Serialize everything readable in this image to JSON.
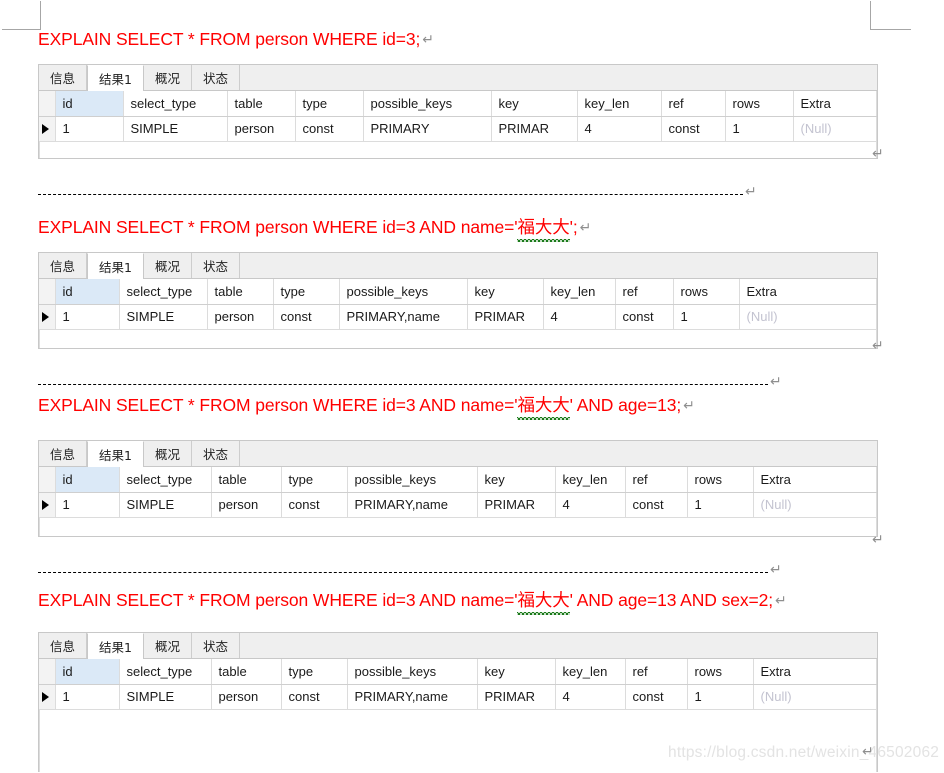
{
  "document": {
    "watermark": "https://blog.csdn.net/weixin_46502062",
    "pilcrow_glyph": "↵",
    "separator_text": "-------------------------------------------------------------------------------------------------------------------"
  },
  "blocks": [
    {
      "sql_prefix": "EXPLAIN SELECT * FROM person WHERE id=3;",
      "sql_cjk": "",
      "sql_suffix": "",
      "tabs": [
        {
          "label": "信息",
          "active": false
        },
        {
          "label": "结果1",
          "active": true
        },
        {
          "label": "概况",
          "active": false
        },
        {
          "label": "状态",
          "active": false
        }
      ],
      "columns": [
        "id",
        "select_type",
        "table",
        "type",
        "possible_keys",
        "key",
        "key_len",
        "ref",
        "rows",
        "Extra"
      ],
      "row": {
        "id": "1",
        "select_type": "SIMPLE",
        "table": "person",
        "type": "const",
        "possible_keys": "PRIMARY",
        "key": "PRIMAR",
        "key_len": "4",
        "ref": "const",
        "rows": "1",
        "extra": "(Null)"
      }
    },
    {
      "sql_prefix": "EXPLAIN SELECT * FROM person WHERE id=3 AND name='",
      "sql_cjk": "福大大",
      "sql_suffix": "';",
      "tabs": [
        {
          "label": "信息",
          "active": false
        },
        {
          "label": "结果1",
          "active": true
        },
        {
          "label": "概况",
          "active": false
        },
        {
          "label": "状态",
          "active": false
        }
      ],
      "columns": [
        "id",
        "select_type",
        "table",
        "type",
        "possible_keys",
        "key",
        "key_len",
        "ref",
        "rows",
        "Extra"
      ],
      "row": {
        "id": "1",
        "select_type": "SIMPLE",
        "table": "person",
        "type": "const",
        "possible_keys": "PRIMARY,name",
        "key": "PRIMAR",
        "key_len": "4",
        "ref": "const",
        "rows": "1",
        "extra": "(Null)"
      }
    },
    {
      "sql_prefix": "EXPLAIN SELECT * FROM person WHERE id=3 AND name='",
      "sql_cjk": "福大大",
      "sql_suffix": "' AND age=13;",
      "tabs": [
        {
          "label": "信息",
          "active": false
        },
        {
          "label": "结果1",
          "active": true
        },
        {
          "label": "概况",
          "active": false
        },
        {
          "label": "状态",
          "active": false
        }
      ],
      "columns": [
        "id",
        "select_type",
        "table",
        "type",
        "possible_keys",
        "key",
        "key_len",
        "ref",
        "rows",
        "Extra"
      ],
      "row": {
        "id": "1",
        "select_type": "SIMPLE",
        "table": "person",
        "type": "const",
        "possible_keys": "PRIMARY,name",
        "key": "PRIMAR",
        "key_len": "4",
        "ref": "const",
        "rows": "1",
        "extra": "(Null)"
      }
    },
    {
      "sql_prefix": "EXPLAIN SELECT * FROM person WHERE id=3 AND name='",
      "sql_cjk": "福大大",
      "sql_suffix": "' AND age=13 AND sex=2;",
      "tabs": [
        {
          "label": "信息",
          "active": false
        },
        {
          "label": "结果1",
          "active": true
        },
        {
          "label": "概况",
          "active": false
        },
        {
          "label": "状态",
          "active": false
        }
      ],
      "columns": [
        "id",
        "select_type",
        "table",
        "type",
        "possible_keys",
        "key",
        "key_len",
        "ref",
        "rows",
        "Extra"
      ],
      "row": {
        "id": "1",
        "select_type": "SIMPLE",
        "table": "person",
        "type": "const",
        "possible_keys": "PRIMARY,name",
        "key": "PRIMAR",
        "key_len": "4",
        "ref": "const",
        "rows": "1",
        "extra": "(Null)"
      }
    }
  ]
}
